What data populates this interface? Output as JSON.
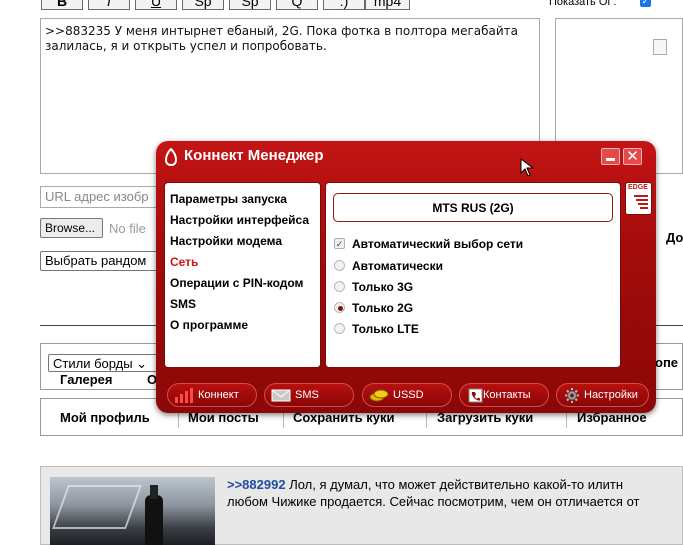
{
  "toolbar": {
    "buttons": [
      {
        "label": "B"
      },
      {
        "label": "I"
      },
      {
        "label": "U"
      },
      {
        "label": "Sp"
      },
      {
        "label": "Q"
      },
      {
        "label": ":)"
      },
      {
        "label": "mp4"
      }
    ],
    "show_og_label": "Показать ОГ:",
    "show_og_checked": true
  },
  "message": {
    "text": ">>883235 У меня интырнет ебаный, 2G. Пока фотка в полтора мегабайта залилась, я и открыть успел и попробовать."
  },
  "form": {
    "url_placeholder": "URL адрес изобр",
    "browse_label": "Browse...",
    "no_file_text": "No file",
    "random_label": "Выбрать рандом",
    "right_cut_text": "До"
  },
  "board": {
    "styles_select": "Стили борды",
    "gallery_label": "Галерея",
    "cut_o": "О",
    "cut_ope": "опе",
    "nav": [
      "Мой профиль",
      "Мои посты",
      "Сохранить куки",
      "Загрузить куки",
      "Избранное"
    ]
  },
  "post": {
    "ref": ">>882992",
    "line1": "Лол, я думал, что может действительно какой-то илитн",
    "line2": "любом Чижике продается. Сейчас посмотрим, чем он отличается от"
  },
  "connect_manager": {
    "title": "Коннект Менеджер",
    "menu": [
      {
        "label": "Параметры запуска",
        "active": false
      },
      {
        "label": "Настройки интерфейса",
        "active": false
      },
      {
        "label": "Настройки модема",
        "active": false
      },
      {
        "label": "Сеть",
        "active": true
      },
      {
        "label": "Операции с PIN-кодом",
        "active": false
      },
      {
        "label": "SMS",
        "active": false
      },
      {
        "label": "О программе",
        "active": false
      }
    ],
    "operator": "MTS RUS (2G)",
    "edge_label": "EDGE",
    "auto_select_label": "Автоматический выбор сети",
    "auto_select_checked": true,
    "options": [
      {
        "label": "Автоматически",
        "selected": false
      },
      {
        "label": "Только 3G",
        "selected": false
      },
      {
        "label": "Только 2G",
        "selected": true
      },
      {
        "label": "Только LTE",
        "selected": false
      }
    ],
    "tabs": [
      "Коннект",
      "SMS",
      "USSD",
      "Контакты",
      "Настройки"
    ],
    "colors": {
      "frame": "#a30c0c",
      "active_menu": "#d11010"
    }
  }
}
